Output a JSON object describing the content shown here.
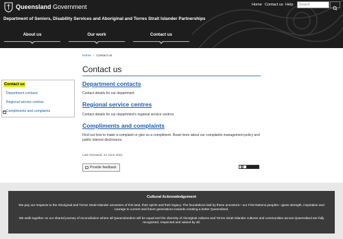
{
  "header": {
    "brand_bold": "Queensland",
    "brand_light": "Government",
    "department": "Department of Seniors, Disability Services and Aboriginal and Torres Strait Islander Partnerships",
    "utility_links": [
      "Home",
      "Contact us",
      "Help"
    ],
    "search_placeholder": "Search"
  },
  "nav": {
    "items": [
      "About us",
      "Our work",
      "Contact us"
    ]
  },
  "breadcrumb": {
    "home": "Home",
    "separator": "›",
    "current": "Contact us"
  },
  "page": {
    "title": "Contact us",
    "sections": [
      {
        "heading": "Department contacts",
        "text": "Contact details for our department."
      },
      {
        "heading": "Regional service centres",
        "text": "Contact details for our department's regional service centres."
      },
      {
        "heading": "Compliments and complaints",
        "text": "Find out how to make a complaint or give us a compliment. Read more about our complaints management policy and public interest disclosures."
      }
    ],
    "last_reviewed": "Last reviewed: 24 June 2021",
    "feedback_label": "Provide feedback"
  },
  "sidebar": {
    "heading": "Contact us",
    "items": [
      "Department contacts",
      "Regional service centres",
      "Compliments and complaints"
    ]
  },
  "acknowledgement": {
    "title": "Cultural Acknowledgement",
    "p1": "We pay our respects to the Aboriginal and Torres Strait Islander ancestors of this land, their spirits and their legacy. The foundations laid by these ancestors—our First Nations peoples—gives strength, inspiration and courage to current and future generations towards creating a better Queensland.",
    "p2": "We walk together on our shared journey of reconciliation where all Queenslanders will be equal and the diversity of Aboriginal cultures and Torres Strait Islander cultures and communities across Queensland are fully recognised, respected and valued by all."
  },
  "colors": {
    "header_bg": "#1d1d1d",
    "link": "#1a5fb4",
    "accent_rule": "#3b7dd8",
    "sidebar_highlight": "#e6ee1c",
    "ack_bg": "#3a3a3a"
  }
}
